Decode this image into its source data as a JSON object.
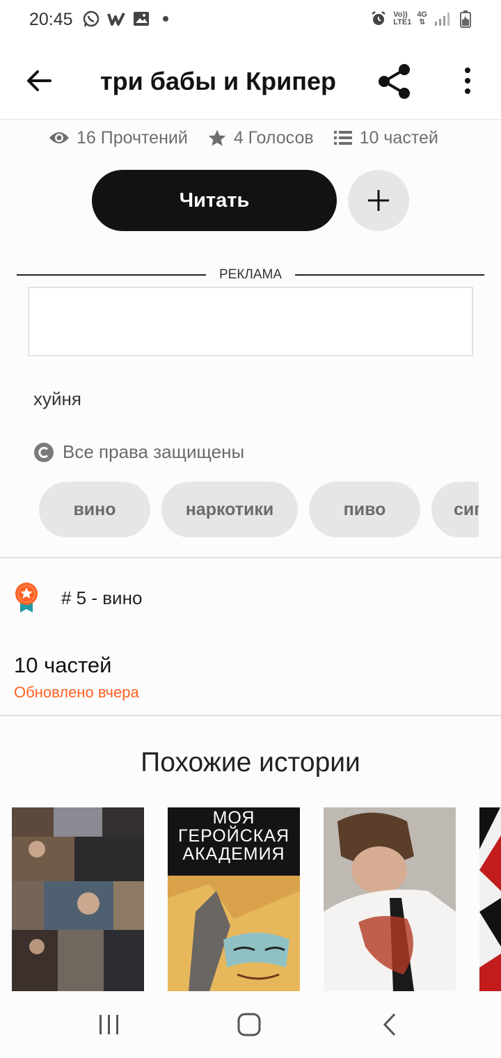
{
  "status_bar": {
    "time": "20:45",
    "network_top": "Vo))",
    "network_bottom": "LTE1",
    "signal_type": "4G"
  },
  "toolbar": {
    "title": "три бабы и Крипер",
    "back_icon": "arrow-left-icon",
    "share_icon": "share-icon",
    "more_icon": "more-vert-icon"
  },
  "stats": {
    "reads": "16 Прочтений",
    "votes": "4 Голосов",
    "parts": "10 частей"
  },
  "actions": {
    "read_label": "Читать",
    "add_icon": "plus-icon"
  },
  "ad": {
    "label": "РЕКЛАМА"
  },
  "story": {
    "description": "хуйня",
    "rights": "Все права защищены",
    "tags": [
      "вино",
      "наркотики",
      "пиво",
      "сигареты"
    ]
  },
  "rank": {
    "text": "# 5 - вино"
  },
  "parts_info": {
    "count": "10 частей",
    "updated": "Обновлено вчера"
  },
  "similar": {
    "title": "Похожие истории",
    "covers": [
      {
        "text": ""
      },
      {
        "text": "МОЯ ГЕРОЙСКАЯ АКАДЕМИЯ"
      },
      {
        "text": ""
      },
      {
        "text": ""
      }
    ]
  },
  "colors": {
    "accent": "#ff6122",
    "primary_button": "#121212",
    "chip": "#e6e5e7"
  }
}
